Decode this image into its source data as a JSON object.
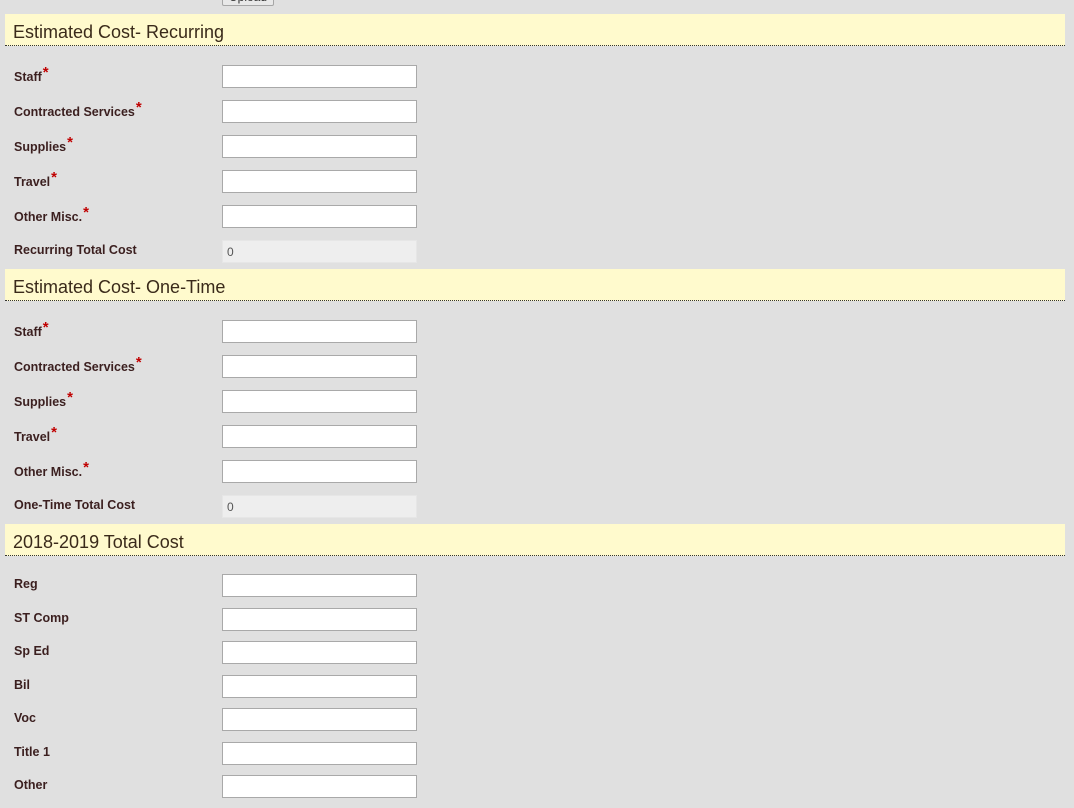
{
  "top": {
    "upload_label": "Upload"
  },
  "sections": [
    {
      "title": "Estimated Cost- Recurring",
      "fields": [
        {
          "label": "Staff",
          "required": true,
          "value": ""
        },
        {
          "label": "Contracted Services",
          "required": true,
          "value": ""
        },
        {
          "label": "Supplies",
          "required": true,
          "value": ""
        },
        {
          "label": "Travel",
          "required": true,
          "value": ""
        },
        {
          "label": "Other Misc.",
          "required": true,
          "value": ""
        }
      ],
      "total": {
        "label": "Recurring Total Cost",
        "value": "0"
      }
    },
    {
      "title": "Estimated Cost- One-Time",
      "fields": [
        {
          "label": "Staff",
          "required": true,
          "value": ""
        },
        {
          "label": "Contracted Services",
          "required": true,
          "value": ""
        },
        {
          "label": "Supplies",
          "required": true,
          "value": ""
        },
        {
          "label": "Travel",
          "required": true,
          "value": ""
        },
        {
          "label": "Other Misc.",
          "required": true,
          "value": ""
        }
      ],
      "total": {
        "label": "One-Time Total Cost",
        "value": "0"
      }
    },
    {
      "title": "2018-2019 Total Cost",
      "fields": [
        {
          "label": "Reg",
          "required": false,
          "value": ""
        },
        {
          "label": "ST Comp",
          "required": false,
          "value": ""
        },
        {
          "label": "Sp Ed",
          "required": false,
          "value": ""
        },
        {
          "label": "Bil",
          "required": false,
          "value": ""
        },
        {
          "label": "Voc",
          "required": false,
          "value": ""
        },
        {
          "label": "Title 1",
          "required": false,
          "value": ""
        },
        {
          "label": "Other",
          "required": false,
          "value": ""
        }
      ]
    }
  ],
  "required_marker": "*",
  "colors": {
    "header_bg": "#fffacd",
    "required": "#c00000",
    "page_bg": "#e0e0e0"
  }
}
